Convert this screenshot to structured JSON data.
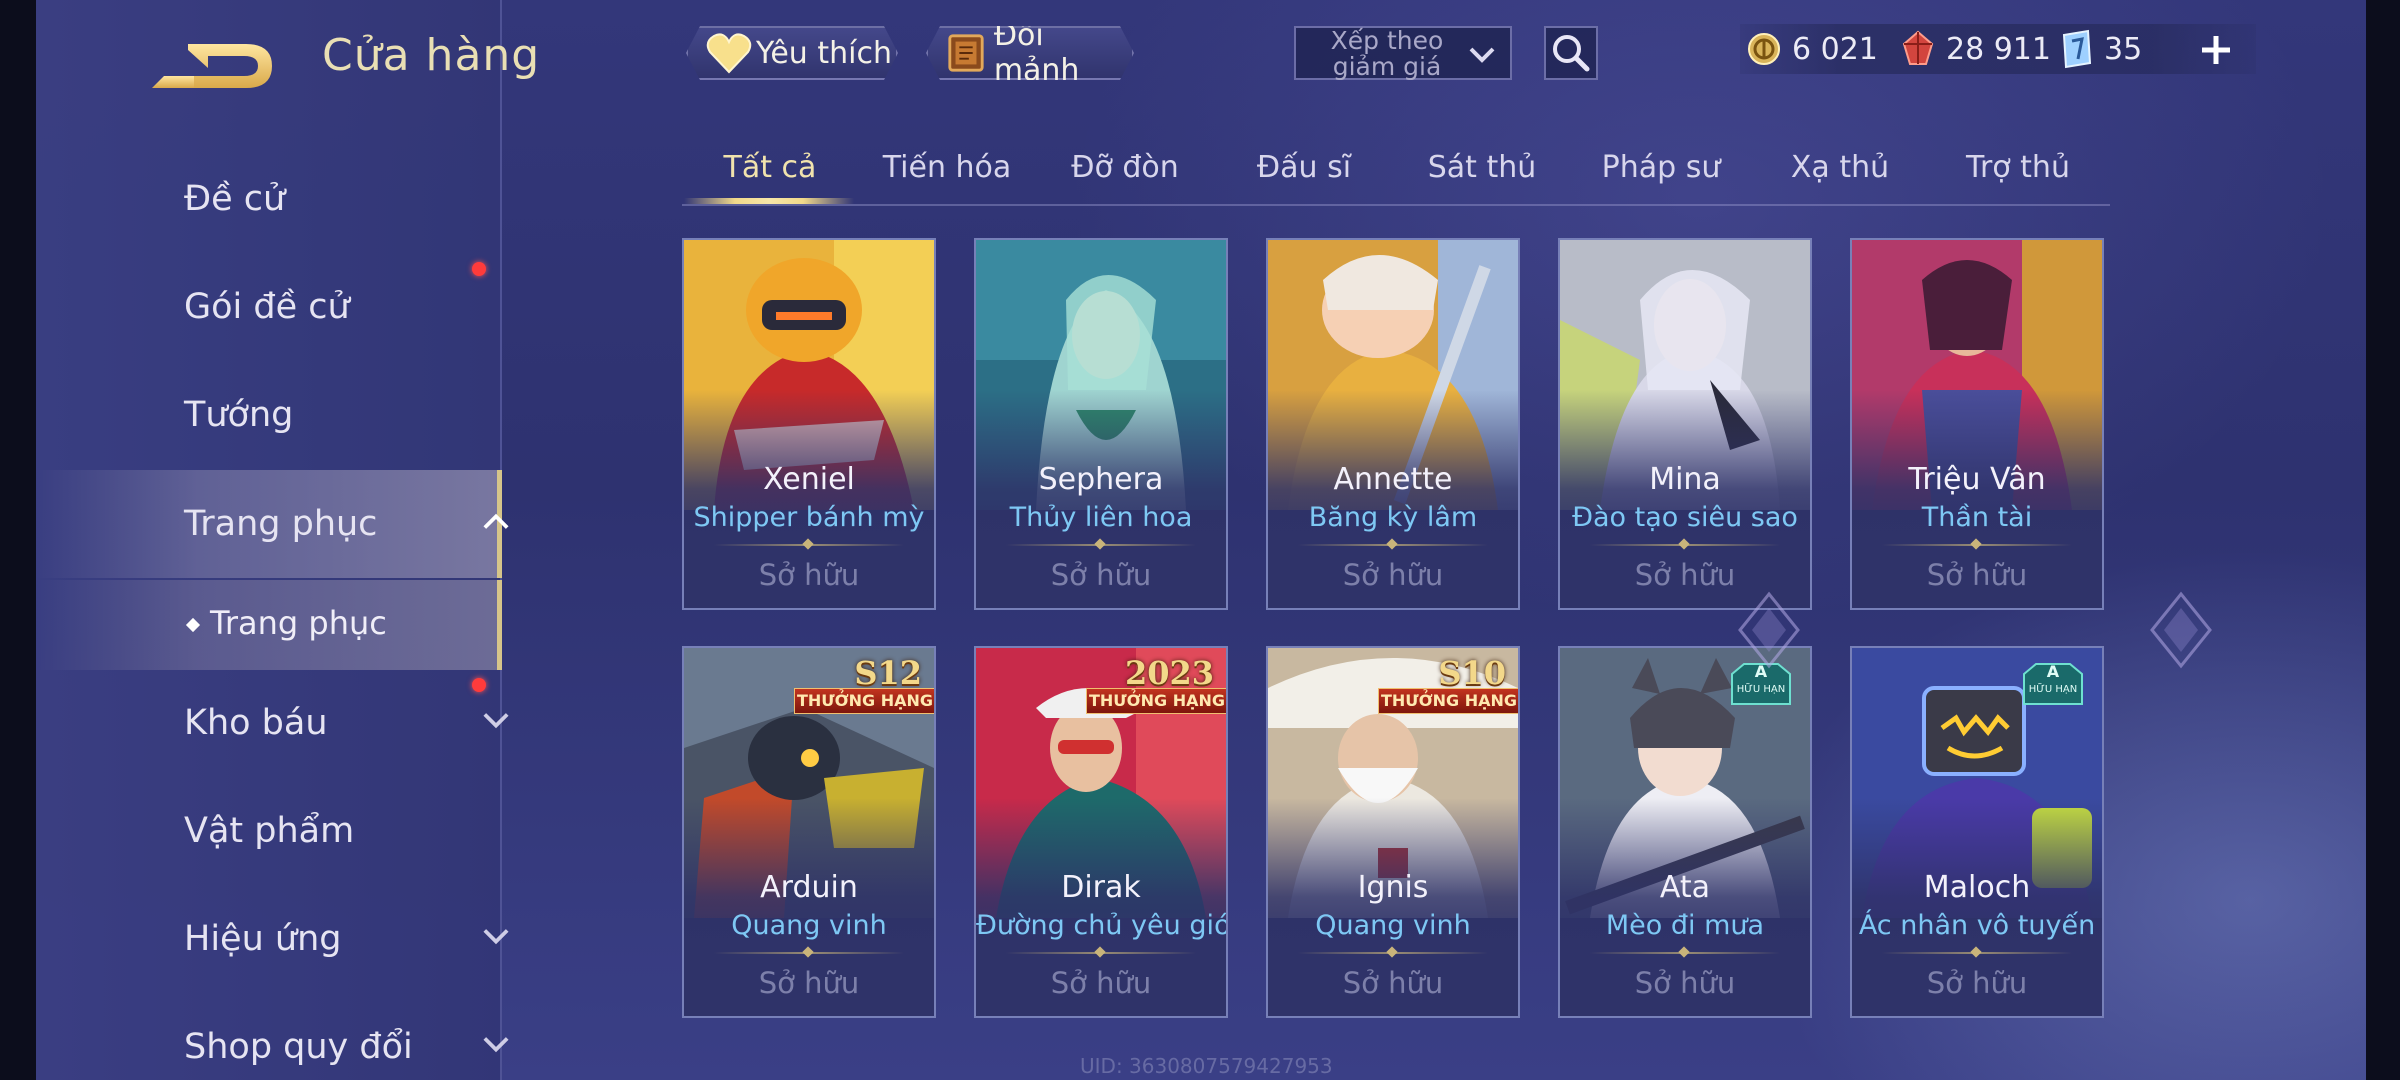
{
  "header": {
    "title": "Cửa hàng",
    "favorites_label": "Yêu thích",
    "exchange_label": "Đổi mảnh",
    "sort_placeholder": "Xếp theo giảm giá"
  },
  "currency": {
    "gold": "6 021",
    "vouchers": "28 911",
    "gems": "35"
  },
  "sidebar": {
    "items": [
      {
        "label": "Đề cử"
      },
      {
        "label": "Gói đề cử"
      },
      {
        "label": "Tướng"
      },
      {
        "label": "Trang phục"
      },
      {
        "label": "Kho báu"
      },
      {
        "label": "Vật phẩm"
      },
      {
        "label": "Hiệu ứng"
      },
      {
        "label": "Shop quy đổi"
      }
    ],
    "sub_item": "Trang phục"
  },
  "tabs": [
    "Tất cả",
    "Tiến hóa",
    "Đỡ đòn",
    "Đấu sĩ",
    "Sát thủ",
    "Pháp sư",
    "Xạ thủ",
    "Trợ thủ"
  ],
  "cards": [
    {
      "hero": "Xeniel",
      "skin": "Shipper bánh mỳ",
      "status": "Sở hữu"
    },
    {
      "hero": "Sephera",
      "skin": "Thủy liên hoa",
      "status": "Sở hữu"
    },
    {
      "hero": "Annette",
      "skin": "Băng kỳ lâm",
      "status": "Sở hữu"
    },
    {
      "hero": "Mina",
      "skin": "Đào tạo siêu sao",
      "status": "Sở hữu"
    },
    {
      "hero": "Triệu Vân",
      "skin": "Thần tài",
      "status": "Sở hữu"
    },
    {
      "hero": "Arduin",
      "skin": "Quang vinh",
      "status": "Sở hữu",
      "badge": "S12",
      "ribbon": "THƯỞNG HẠNG"
    },
    {
      "hero": "Dirak",
      "skin": "Đường chủ yêu giới",
      "status": "Sở hữu",
      "badge": "2023",
      "ribbon": "THƯỞNG HẠNG"
    },
    {
      "hero": "Ignis",
      "skin": "Quang vinh",
      "status": "Sở hữu",
      "badge": "S10",
      "ribbon": "THƯỞNG HẠNG"
    },
    {
      "hero": "Ata",
      "skin": "Mèo đi mưa",
      "status": "Sở hữu",
      "limited": "A",
      "limited_text": "HỮU HẠN"
    },
    {
      "hero": "Maloch",
      "skin": "Ác nhân vô tuyến",
      "status": "Sở hữu",
      "limited": "A",
      "limited_text": "HỮU HẠN"
    }
  ],
  "footer": {
    "uid": "UID: 3630807579427953"
  },
  "colors": {
    "accent_gold": "#f1e3ad",
    "skin_name": "#7ec8f4",
    "notification_dot": "#ff3b3b",
    "background": "#2e3270"
  }
}
